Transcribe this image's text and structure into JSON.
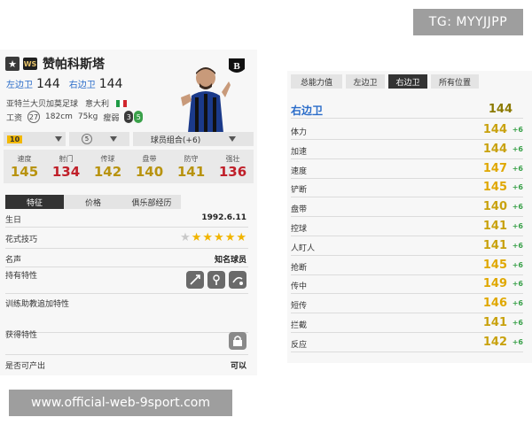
{
  "watermarks": {
    "top": "TG: MYYJJPP",
    "bottom": "www.official-web-9sport.com"
  },
  "colors": {
    "accent_blue": "#2a6cc9",
    "high": "#f1b400",
    "green_bonus": "#3aa14a",
    "red_val": "#c0202a",
    "gold_val": "#b8930f",
    "dark_gold": "#8c7a00"
  },
  "player": {
    "star_icon": "star-icon",
    "season_badge": "WS",
    "name": "赞帕科斯塔",
    "positions": [
      {
        "pos": "左边卫",
        "val": "144"
      },
      {
        "pos": "右边卫",
        "val": "144"
      }
    ],
    "club": "亚特兰大贝加莫足球",
    "nation": "意大利",
    "wage_label": "工资",
    "wage": "27",
    "height": "182cm",
    "weight": "75kg",
    "foot": "瘦弱",
    "foot_l": "3",
    "foot_r": "5"
  },
  "dropdowns": {
    "level": "10",
    "grade": "5",
    "combo": "球员组合(+6)"
  },
  "stats": [
    {
      "label": "速度",
      "value": "145",
      "tone": "gold"
    },
    {
      "label": "射门",
      "value": "134",
      "tone": "red"
    },
    {
      "label": "传球",
      "value": "142",
      "tone": "gold"
    },
    {
      "label": "盘带",
      "value": "140",
      "tone": "gold"
    },
    {
      "label": "防守",
      "value": "141",
      "tone": "gold"
    },
    {
      "label": "强壮",
      "value": "136",
      "tone": "red"
    }
  ],
  "tabs": [
    "特征",
    "价格",
    "俱乐部经历"
  ],
  "traits_table": {
    "birthday_label": "生日",
    "birthday": "1992.6.11",
    "skill_label": "花式技巧",
    "skill_stars": 5,
    "reputation_label": "名声",
    "reputation": "知名球员",
    "traits_label": "持有特性",
    "training_label": "训练助教追加特性",
    "acquired_label": "获得特性",
    "producible_label": "是否可产出",
    "producible": "可以"
  },
  "right": {
    "tabs": [
      "总能力值",
      "左边卫",
      "右边卫",
      "所有位置"
    ],
    "title_label": "右边卫",
    "title_value": "144",
    "attrs": [
      {
        "label": "体力",
        "value": "144",
        "bonus": "+6"
      },
      {
        "label": "加速",
        "value": "144",
        "bonus": "+6"
      },
      {
        "label": "速度",
        "value": "147",
        "bonus": "+6"
      },
      {
        "label": "铲断",
        "value": "145",
        "bonus": "+6"
      },
      {
        "label": "盘带",
        "value": "140",
        "bonus": "+6"
      },
      {
        "label": "控球",
        "value": "141",
        "bonus": "+6"
      },
      {
        "label": "人盯人",
        "value": "141",
        "bonus": "+6"
      },
      {
        "label": "抢断",
        "value": "145",
        "bonus": "+6"
      },
      {
        "label": "传中",
        "value": "149",
        "bonus": "+6"
      },
      {
        "label": "短传",
        "value": "146",
        "bonus": "+6"
      },
      {
        "label": "拦截",
        "value": "141",
        "bonus": "+6"
      },
      {
        "label": "反应",
        "value": "142",
        "bonus": "+6"
      }
    ]
  }
}
